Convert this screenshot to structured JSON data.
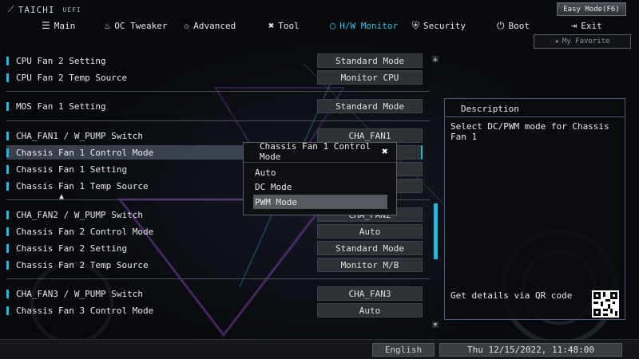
{
  "header": {
    "brand": "TAICHI",
    "brand_suffix": "UEFI",
    "tabs": [
      {
        "label": "Main",
        "icon": "list-icon"
      },
      {
        "label": "OC Tweaker",
        "icon": "flame-icon"
      },
      {
        "label": "Advanced",
        "icon": "star-icon"
      },
      {
        "label": "Tool",
        "icon": "tool-icon"
      },
      {
        "label": "H/W Monitor",
        "icon": "monitor-ring-icon",
        "active": true
      },
      {
        "label": "Security",
        "icon": "shield-icon"
      },
      {
        "label": "Boot",
        "icon": "power-icon"
      },
      {
        "label": "Exit",
        "icon": "exit-icon"
      }
    ],
    "easy_mode": "Easy Mode(F6)",
    "favorite": "My Favorite"
  },
  "settings": [
    {
      "label": "CPU Fan 2 Setting",
      "value": "Standard Mode"
    },
    {
      "label": "CPU Fan 2 Temp Source",
      "value": "Monitor CPU"
    },
    {
      "label": "MOS Fan 1 Setting",
      "value": "Standard Mode"
    },
    {
      "label": "CHA_FAN1 / W_PUMP Switch",
      "value": "CHA_FAN1"
    },
    {
      "label": "Chassis Fan 1 Control Mode",
      "value": ""
    },
    {
      "label": "Chassis Fan 1 Setting",
      "value": ""
    },
    {
      "label": "Chassis Fan 1 Temp Source",
      "value": ""
    },
    {
      "label": "CHA_FAN2 / W_PUMP Switch",
      "value": "CHA_FAN2"
    },
    {
      "label": "Chassis Fan 2 Control Mode",
      "value": "Auto"
    },
    {
      "label": "Chassis Fan 2 Setting",
      "value": "Standard Mode"
    },
    {
      "label": "Chassis Fan 2 Temp Source",
      "value": "Monitor M/B"
    },
    {
      "label": "CHA_FAN3 / W_PUMP Switch",
      "value": "CHA_FAN3"
    },
    {
      "label": "Chassis Fan 3 Control Mode",
      "value": "Auto"
    }
  ],
  "description": {
    "title": "Description",
    "text": "Select DC/PWM mode for Chassis Fan 1",
    "qr_text": "Get details via QR code"
  },
  "popup": {
    "title": "Chassis Fan 1 Control Mode",
    "options": [
      "Auto",
      "DC Mode",
      "PWM Mode"
    ],
    "selected": "PWM Mode"
  },
  "footer": {
    "language": "English",
    "datetime": "Thu 12/15/2022, 11:48:00"
  },
  "colors": {
    "accent": "#22b8e0",
    "active_tab": "#2ec5ea",
    "value_bg": "#2e3136"
  }
}
